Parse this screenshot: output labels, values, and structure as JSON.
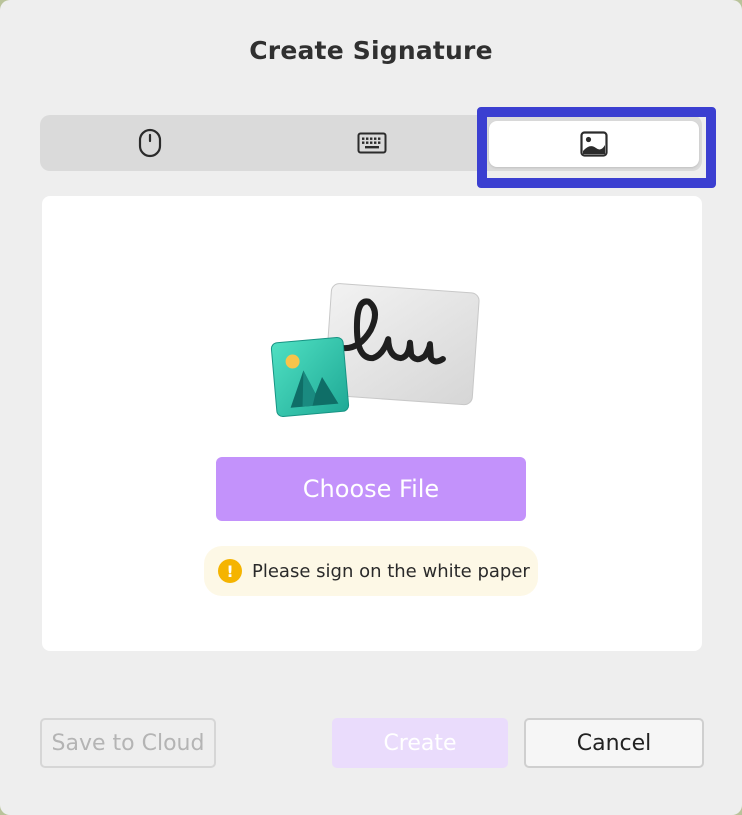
{
  "dialog": {
    "title": "Create Signature"
  },
  "tabs": [
    {
      "name": "draw",
      "icon": "mouse-icon"
    },
    {
      "name": "type",
      "icon": "keyboard-icon"
    },
    {
      "name": "image",
      "icon": "image-icon",
      "selected": true
    }
  ],
  "upload": {
    "choose_label": "Choose File",
    "hint_icon": "!",
    "hint_text": "Please sign on the white paper"
  },
  "footer": {
    "save_label": "Save to Cloud",
    "create_label": "Create",
    "cancel_label": "Cancel"
  },
  "colors": {
    "accent": "#c392fb",
    "selection_outline": "#3b3fd1",
    "warning": "#f5b400"
  }
}
